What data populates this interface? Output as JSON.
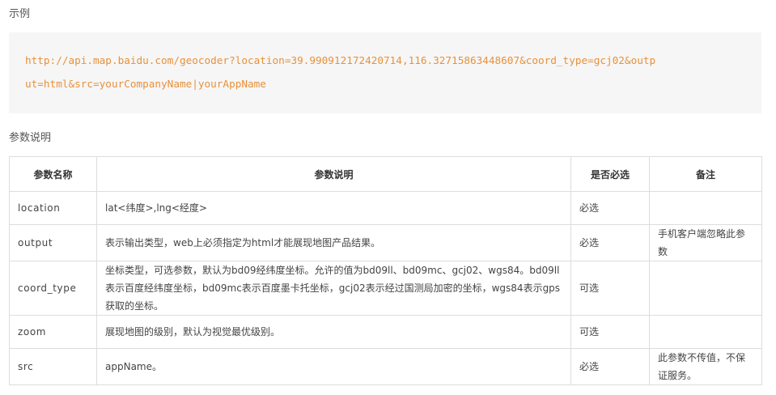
{
  "example": {
    "title": "示例",
    "code_lines": [
      "http://api.map.baidu.com/geocoder?location=39.990912172420714,116.32715863448607&coord_type=gcj02&outp",
      "ut=html&src=yourCompanyName|yourAppName"
    ]
  },
  "params": {
    "title": "参数说明",
    "columns": [
      "参数名称",
      "参数说明",
      "是否必选",
      "备注"
    ],
    "rows": [
      {
        "name": "location",
        "desc": "lat<纬度>,lng<经度>",
        "required": "必选",
        "note": ""
      },
      {
        "name": "output",
        "desc": "表示输出类型，web上必须指定为html才能展现地图产品结果。",
        "required": "必选",
        "note": "手机客户端忽略此参数"
      },
      {
        "name": "coord_type",
        "desc": "坐标类型，可选参数，默认为bd09经纬度坐标。允许的值为bd09ll、bd09mc、gcj02、wgs84。bd09ll表示百度经纬度坐标，bd09mc表示百度墨卡托坐标，gcj02表示经过国测局加密的坐标，wgs84表示gps获取的坐标。",
        "required": "可选",
        "note": ""
      },
      {
        "name": "zoom",
        "desc": "展现地图的级别，默认为视觉最优级别。",
        "required": "可选",
        "note": ""
      },
      {
        "name": "src",
        "desc": "appName。",
        "required": "必选",
        "note": "此参数不传值，不保证服务。"
      }
    ]
  }
}
